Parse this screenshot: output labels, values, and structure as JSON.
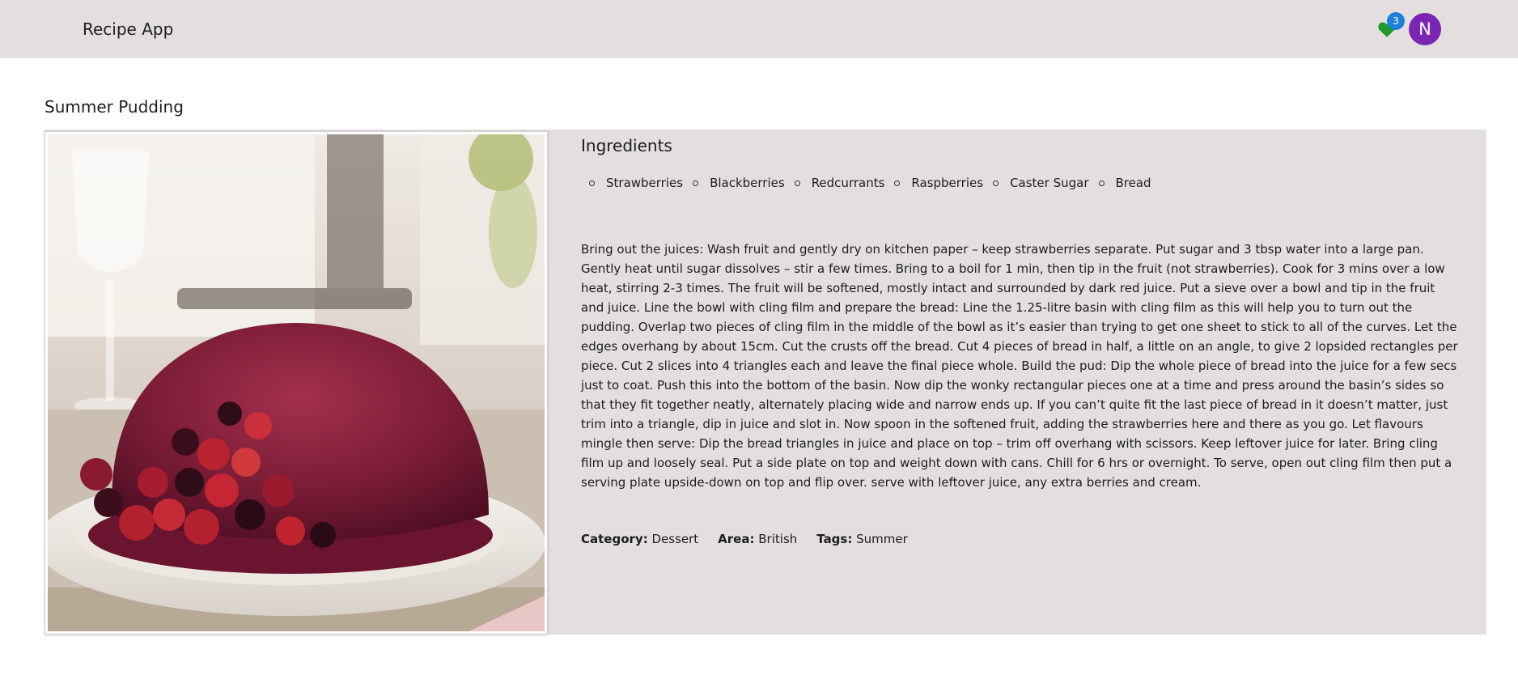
{
  "header": {
    "app_title": "Recipe App",
    "favorites_count": "3",
    "avatar_initial": "N",
    "favorites_icon": "heart-icon",
    "colors": {
      "header_bg": "#e3dfdf",
      "favorite": "#1e9a2d",
      "badge": "#1e7fdc",
      "avatar": "#7b25b4"
    }
  },
  "recipe": {
    "title": "Summer Pudding",
    "image_alt": "summer-pudding-photo",
    "ingredients_heading": "Ingredients",
    "ingredients": [
      "Strawberries",
      "Blackberries",
      "Redcurrants",
      "Raspberries",
      "Caster Sugar",
      "Bread"
    ],
    "instructions": "Bring out the juices: Wash fruit and gently dry on kitchen paper – keep strawberries separate. Put sugar and 3 tbsp water into a large pan. Gently heat until sugar dissolves – stir a few times. Bring to a boil for 1 min, then tip in the fruit (not strawberries). Cook for 3 mins over a low heat, stirring 2-3 times. The fruit will be softened, mostly intact and surrounded by dark red juice. Put a sieve over a bowl and tip in the fruit and juice. Line the bowl with cling film and prepare the bread: Line the 1.25-litre basin with cling film as this will help you to turn out the pudding. Overlap two pieces of cling film in the middle of the bowl as it’s easier than trying to get one sheet to stick to all of the curves. Let the edges overhang by about 15cm. Cut the crusts off the bread. Cut 4 pieces of bread in half, a little on an angle, to give 2 lopsided rectangles per piece. Cut 2 slices into 4 triangles each and leave the final piece whole. Build the pud: Dip the whole piece of bread into the juice for a few secs just to coat. Push this into the bottom of the basin. Now dip the wonky rectangular pieces one at a time and press around the basin’s sides so that they fit together neatly, alternately placing wide and narrow ends up. If you can’t quite fit the last piece of bread in it doesn’t matter, just trim into a triangle, dip in juice and slot in. Now spoon in the softened fruit, adding the strawberries here and there as you go. Let flavours mingle then serve: Dip the bread triangles in juice and place on top – trim off overhang with scissors. Keep leftover juice for later. Bring cling film up and loosely seal. Put a side plate on top and weight down with cans. Chill for 6 hrs or overnight. To serve, open out cling film then put a serving plate upside-down on top and flip over. serve with leftover juice, any extra berries and cream.",
    "category_label": "Category:",
    "category": "Dessert",
    "area_label": "Area:",
    "area": "British",
    "tags_label": "Tags:",
    "tags": "Summer"
  }
}
